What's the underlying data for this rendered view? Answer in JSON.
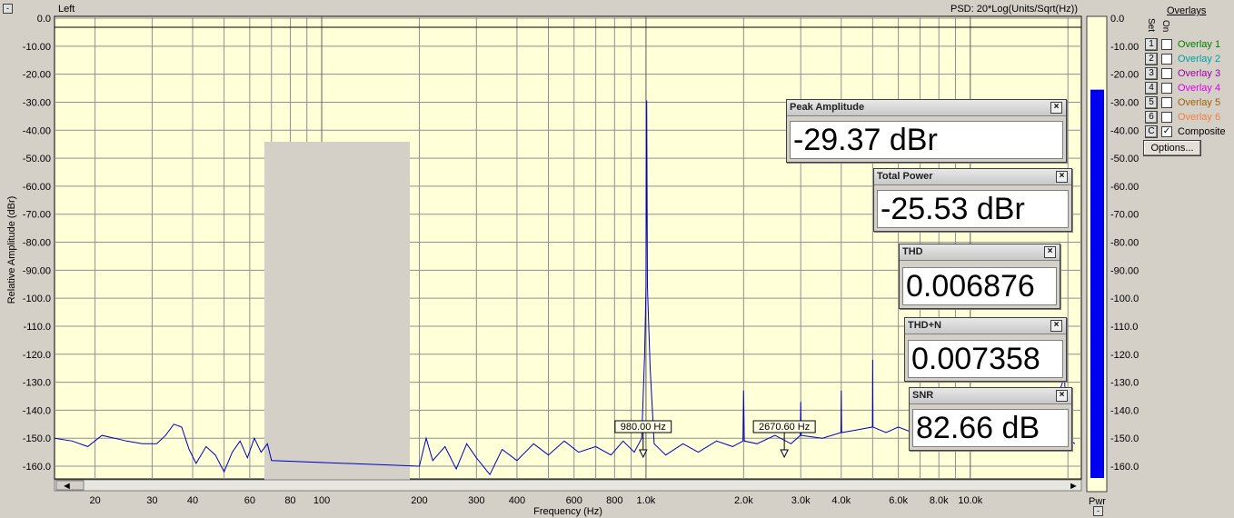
{
  "window": {
    "channel_label": "Left",
    "psd_label": "PSD: 20*Log(Units/Sqrt(Hz))"
  },
  "chart_data": {
    "type": "line",
    "xlabel": "Frequency (Hz)",
    "ylabel": "Relative Amplitude (dBr)",
    "x_scale": "log",
    "xlim": [
      15,
      22000
    ],
    "ylim": [
      -165,
      0
    ],
    "grid": true,
    "y_tick_labels": [
      "0.0",
      "-10.00",
      "-20.00",
      "-30.00",
      "-40.00",
      "-50.00",
      "-60.00",
      "-70.00",
      "-80.00",
      "-90.00",
      "-100.0",
      "-110.0",
      "-120.0",
      "-130.0",
      "-140.0",
      "-150.0",
      "-160.0"
    ],
    "x_tick_labels": [
      {
        "v": 20,
        "t": "20"
      },
      {
        "v": 30,
        "t": "30"
      },
      {
        "v": 40,
        "t": "40"
      },
      {
        "v": 60,
        "t": "60"
      },
      {
        "v": 80,
        "t": "80"
      },
      {
        "v": 100,
        "t": "100"
      },
      {
        "v": 200,
        "t": "200"
      },
      {
        "v": 300,
        "t": "300"
      },
      {
        "v": 400,
        "t": "400"
      },
      {
        "v": 600,
        "t": "600"
      },
      {
        "v": 800,
        "t": "800"
      },
      {
        "v": 1000,
        "t": "1.0k"
      },
      {
        "v": 2000,
        "t": "2.0k"
      },
      {
        "v": 3000,
        "t": "3.0k"
      },
      {
        "v": 4000,
        "t": "4.0k"
      },
      {
        "v": 6000,
        "t": "6.0k"
      },
      {
        "v": 8000,
        "t": "8.0k"
      },
      {
        "v": 10000,
        "t": "10.0k"
      }
    ],
    "series": [
      {
        "color": "#0000c0",
        "points": [
          [
            15,
            -150
          ],
          [
            17,
            -151
          ],
          [
            19,
            -153
          ],
          [
            21,
            -149
          ],
          [
            23,
            -150
          ],
          [
            25,
            -151
          ],
          [
            28,
            -152
          ],
          [
            31,
            -152
          ],
          [
            33,
            -149
          ],
          [
            35,
            -145
          ],
          [
            37,
            -146
          ],
          [
            39,
            -154
          ],
          [
            41,
            -159
          ],
          [
            44,
            -153
          ],
          [
            47,
            -156
          ],
          [
            50,
            -162
          ],
          [
            53,
            -155
          ],
          [
            56,
            -151
          ],
          [
            59,
            -157
          ],
          [
            62,
            -150
          ],
          [
            65,
            -155
          ],
          [
            68,
            -152
          ],
          [
            70,
            -158
          ],
          [
            200,
            -160
          ],
          [
            210,
            -150
          ],
          [
            220,
            -158
          ],
          [
            240,
            -153
          ],
          [
            260,
            -161
          ],
          [
            280,
            -152
          ],
          [
            300,
            -157
          ],
          [
            330,
            -163
          ],
          [
            360,
            -154
          ],
          [
            400,
            -158
          ],
          [
            450,
            -152
          ],
          [
            500,
            -156
          ],
          [
            560,
            -151
          ],
          [
            620,
            -155
          ],
          [
            700,
            -153
          ],
          [
            780,
            -156
          ],
          [
            850,
            -151
          ],
          [
            920,
            -155
          ],
          [
            970,
            -150
          ],
          [
            990,
            -120
          ],
          [
            1000,
            -96
          ],
          [
            1005,
            -29.37
          ],
          [
            1010,
            -96
          ],
          [
            1030,
            -125
          ],
          [
            1060,
            -152
          ],
          [
            1150,
            -156
          ],
          [
            1300,
            -152
          ],
          [
            1450,
            -155
          ],
          [
            1650,
            -151
          ],
          [
            1850,
            -153
          ],
          [
            1990,
            -151
          ],
          [
            2000,
            -133
          ],
          [
            2010,
            -151
          ],
          [
            2200,
            -152
          ],
          [
            2500,
            -149
          ],
          [
            2800,
            -152
          ],
          [
            2990,
            -149
          ],
          [
            3000,
            -137
          ],
          [
            3010,
            -149
          ],
          [
            3500,
            -150
          ],
          [
            3990,
            -148
          ],
          [
            4000,
            -133
          ],
          [
            4010,
            -148
          ],
          [
            4500,
            -147
          ],
          [
            4990,
            -146
          ],
          [
            5000,
            -122
          ],
          [
            5010,
            -146
          ],
          [
            5500,
            -148
          ],
          [
            6000,
            -146
          ],
          [
            7000,
            -149
          ],
          [
            8000,
            -147
          ],
          [
            9000,
            -149
          ],
          [
            10000,
            -147
          ],
          [
            12000,
            -150
          ],
          [
            14000,
            -148
          ],
          [
            16000,
            -151
          ],
          [
            18000,
            -148
          ],
          [
            19000,
            -132
          ],
          [
            19500,
            -128
          ],
          [
            20000,
            -150
          ],
          [
            21000,
            -152
          ]
        ]
      }
    ],
    "annotations": [
      {
        "text": "980.00 Hz",
        "x": 980
      },
      {
        "text": "2670.60 Hz",
        "x": 2670
      }
    ]
  },
  "meter": {
    "label": "Pwr",
    "level_db": -25.53,
    "scale_labels": [
      "0.0",
      "-10.00",
      "-20.00",
      "-30.00",
      "-40.00",
      "-50.00",
      "-60.00",
      "-70.00",
      "-80.00",
      "-90.00",
      "-100.0",
      "-110.0",
      "-120.0",
      "-130.0",
      "-140.0",
      "-150.0",
      "-160.0"
    ]
  },
  "overlays": {
    "title": "Overlays",
    "set_header": "Set",
    "on_header": "On",
    "items": [
      {
        "set": "1",
        "label": "Overlay 1",
        "color": "#008000",
        "checked": false
      },
      {
        "set": "2",
        "label": "Overlay 2",
        "color": "#00a0a0",
        "checked": false
      },
      {
        "set": "3",
        "label": "Overlay 3",
        "color": "#a000a0",
        "checked": false
      },
      {
        "set": "4",
        "label": "Overlay 4",
        "color": "#e000e0",
        "checked": false
      },
      {
        "set": "5",
        "label": "Overlay 5",
        "color": "#a06000",
        "checked": false
      },
      {
        "set": "6",
        "label": "Overlay 6",
        "color": "#f08040",
        "checked": false
      },
      {
        "set": "C",
        "label": "Composite",
        "color": "#000000",
        "checked": true
      }
    ],
    "options_label": "Options..."
  },
  "readouts": {
    "peak": {
      "title": "Peak Amplitude",
      "value": "-29.37 dBr"
    },
    "power": {
      "title": "Total Power",
      "value": "-25.53 dBr"
    },
    "thd": {
      "title": "THD",
      "value": "0.006876"
    },
    "thdn": {
      "title": "THD+N",
      "value": "0.007358"
    },
    "snr": {
      "title": "SNR",
      "value": "82.66 dB"
    },
    "close_glyph": "×"
  },
  "scrollbar": {
    "left_arrow": "◄",
    "right_arrow": "►"
  },
  "corner_buttons": {
    "minus": "-"
  }
}
